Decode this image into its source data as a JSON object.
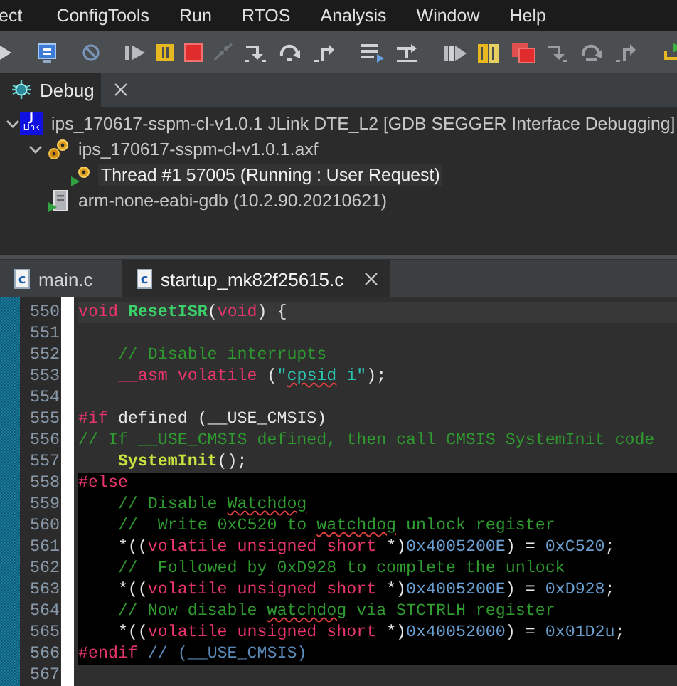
{
  "menu": [
    "ect",
    "ConfigTools",
    "Run",
    "RTOS",
    "Analysis",
    "Window",
    "Help"
  ],
  "debug_view": {
    "tab": {
      "label": "Debug",
      "selected": true
    },
    "tree": [
      {
        "kind": "launch",
        "logo": {
          "top": "J",
          "bottom": "Link"
        },
        "label": "ips_170617-sspm-cl-v1.0.1 JLink DTE_L2 [GDB SEGGER Interface Debugging]",
        "expanded": true,
        "selected": false,
        "children": [
          {
            "kind": "process",
            "label": "ips_170617-sspm-cl-v1.0.1.axf",
            "expanded": true,
            "selected": false,
            "children": [
              {
                "kind": "thread",
                "label": "Thread #1 57005 (Running : User Request)",
                "selected": true
              }
            ]
          },
          {
            "kind": "debugger",
            "label": "arm-none-eabi-gdb (10.2.90.20210621)",
            "selected": false
          }
        ]
      }
    ]
  },
  "editor": {
    "tabs": [
      {
        "label": "main.c",
        "icon_letter": "c",
        "selected": false
      },
      {
        "label": "startup_mk82f25615.c",
        "icon_letter": "c",
        "selected": true
      }
    ],
    "lines": [
      {
        "number": "550",
        "kind": "current",
        "indented": false,
        "tokens": [
          {
            "kind": "keyword",
            "text": "void",
            "misspelled": false
          },
          {
            "kind": "function",
            "text": "ResetISR",
            "misspelled": false,
            "space_before": true
          },
          {
            "kind": "plain",
            "text": "(",
            "misspelled": false
          },
          {
            "kind": "keyword",
            "text": "void",
            "misspelled": false
          },
          {
            "kind": "plain",
            "text": ") {",
            "misspelled": false
          }
        ]
      },
      {
        "number": "551",
        "kind": "plain"
      },
      {
        "number": "552",
        "kind": "plain",
        "indented": true,
        "tokens": [
          {
            "kind": "comment",
            "text": "// Disable interrupts",
            "misspelled": false
          }
        ]
      },
      {
        "number": "553",
        "kind": "plain",
        "indented": true,
        "tokens": [
          {
            "kind": "keyword",
            "text": "__asm volatile",
            "misspelled": false
          },
          {
            "kind": "plain",
            "text": " (",
            "misspelled": false
          },
          {
            "kind": "string",
            "text": "\"",
            "misspelled": false
          },
          {
            "kind": "string",
            "text": "cpsid",
            "misspelled": true
          },
          {
            "kind": "string",
            "text": " i\"",
            "misspelled": false
          },
          {
            "kind": "plain",
            "text": ");",
            "misspelled": false
          }
        ]
      },
      {
        "number": "554",
        "kind": "plain"
      },
      {
        "number": "555",
        "kind": "plain",
        "indented": false,
        "tokens": [
          {
            "kind": "keyword",
            "text": "#if",
            "misspelled": false
          },
          {
            "kind": "plain",
            "text": " defined (__USE_CMSIS)",
            "misspelled": false
          }
        ]
      },
      {
        "number": "556",
        "kind": "plain",
        "indented": false,
        "tokens": [
          {
            "kind": "comment",
            "text": "// If __USE_CMSIS defined, then call CMSIS SystemInit code",
            "misspelled": false
          }
        ]
      },
      {
        "number": "557",
        "kind": "plain",
        "indented": true,
        "tokens": [
          {
            "kind": "call",
            "text": "SystemInit",
            "misspelled": false
          },
          {
            "kind": "plain",
            "text": "();",
            "misspelled": false
          }
        ]
      },
      {
        "number": "558",
        "kind": "inactive",
        "indented": false,
        "tokens": [
          {
            "kind": "keyword",
            "text": "#else",
            "misspelled": false
          }
        ]
      },
      {
        "number": "559",
        "kind": "inactive",
        "indented": true,
        "tokens": [
          {
            "kind": "comment",
            "text": "// Disable ",
            "misspelled": false
          },
          {
            "kind": "comment",
            "text": "Watchdog",
            "misspelled": true
          }
        ]
      },
      {
        "number": "560",
        "kind": "inactive",
        "indented": true,
        "tokens": [
          {
            "kind": "comment",
            "text": "//  Write 0xC520 to ",
            "misspelled": false
          },
          {
            "kind": "comment",
            "text": "watchdog",
            "misspelled": true
          },
          {
            "kind": "comment",
            "text": " unlock register",
            "misspelled": false
          }
        ]
      },
      {
        "number": "561",
        "kind": "inactive",
        "indented": true,
        "tokens": [
          {
            "kind": "plain",
            "text": "*((",
            "misspelled": false
          },
          {
            "kind": "keyword",
            "text": "volatile unsigned short",
            "misspelled": false
          },
          {
            "kind": "plain",
            "text": " *)",
            "misspelled": false
          },
          {
            "kind": "number",
            "text": "0x4005200E",
            "misspelled": false
          },
          {
            "kind": "plain",
            "text": ") = ",
            "misspelled": false
          },
          {
            "kind": "number",
            "text": "0xC520",
            "misspelled": false
          },
          {
            "kind": "plain",
            "text": ";",
            "misspelled": false
          }
        ]
      },
      {
        "number": "562",
        "kind": "inactive",
        "indented": true,
        "tokens": [
          {
            "kind": "comment",
            "text": "//  Followed by 0xD928 to complete the unlock",
            "misspelled": false
          }
        ]
      },
      {
        "number": "563",
        "kind": "inactive",
        "indented": true,
        "tokens": [
          {
            "kind": "plain",
            "text": "*((",
            "misspelled": false
          },
          {
            "kind": "keyword",
            "text": "volatile unsigned short",
            "misspelled": false
          },
          {
            "kind": "plain",
            "text": " *)",
            "misspelled": false
          },
          {
            "kind": "number",
            "text": "0x4005200E",
            "misspelled": false
          },
          {
            "kind": "plain",
            "text": ") = ",
            "misspelled": false
          },
          {
            "kind": "number",
            "text": "0xD928",
            "misspelled": false
          },
          {
            "kind": "plain",
            "text": ";",
            "misspelled": false
          }
        ]
      },
      {
        "number": "564",
        "kind": "inactive",
        "indented": true,
        "tokens": [
          {
            "kind": "comment",
            "text": "// Now disable ",
            "misspelled": false
          },
          {
            "kind": "comment",
            "text": "watchdog",
            "misspelled": true
          },
          {
            "kind": "comment",
            "text": " via STCTRLH register",
            "misspelled": false
          }
        ]
      },
      {
        "number": "565",
        "kind": "inactive",
        "indented": true,
        "tokens": [
          {
            "kind": "plain",
            "text": "*((",
            "misspelled": false
          },
          {
            "kind": "keyword",
            "text": "volatile unsigned short",
            "misspelled": false
          },
          {
            "kind": "plain",
            "text": " *)",
            "misspelled": false
          },
          {
            "kind": "number",
            "text": "0x40052000",
            "misspelled": false
          },
          {
            "kind": "plain",
            "text": ") = ",
            "misspelled": false
          },
          {
            "kind": "number",
            "text": "0x01D2u",
            "misspelled": false
          },
          {
            "kind": "plain",
            "text": ";",
            "misspelled": false
          }
        ]
      },
      {
        "number": "566",
        "kind": "inactive",
        "indented": false,
        "tokens": [
          {
            "kind": "keyword",
            "text": "#endif",
            "misspelled": false
          },
          {
            "kind": "macro_comment",
            "text": " // (__USE_CMSIS)",
            "misspelled": false
          }
        ]
      },
      {
        "number": "567",
        "kind": "plain"
      }
    ]
  }
}
